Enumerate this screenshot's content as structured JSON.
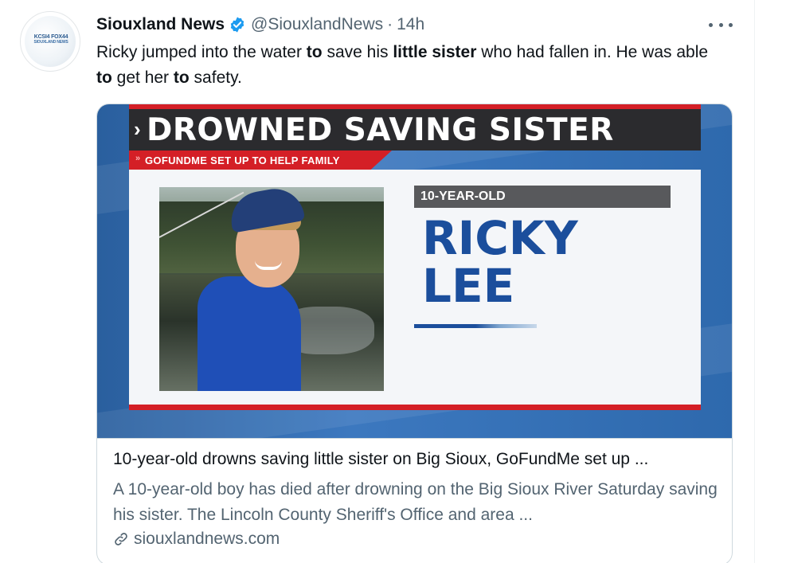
{
  "tweet": {
    "author_name": "Siouxland News",
    "handle": "@SiouxlandNews",
    "separator": "·",
    "time": "14h",
    "text_parts": [
      {
        "t": "Ricky jumped into the water ",
        "b": false
      },
      {
        "t": "to",
        "b": true
      },
      {
        "t": " save his ",
        "b": false
      },
      {
        "t": "little sister",
        "b": true
      },
      {
        "t": " who had fallen in. He was able ",
        "b": false
      },
      {
        "t": "to",
        "b": true
      },
      {
        "t": " get her ",
        "b": false
      },
      {
        "t": "to",
        "b": true
      },
      {
        "t": " safety.",
        "b": false
      }
    ],
    "avatar_logo": {
      "line1": "KCSI4 FOX44",
      "line2": "SIOUXLAND NEWS"
    }
  },
  "card": {
    "graphic": {
      "headline": "DROWNED SAVING SISTER",
      "subheadline": "GOFUNDME SET UP TO HELP FAMILY",
      "age_label": "10-YEAR-OLD",
      "name_line1": "RICKY",
      "name_line2": "LEE"
    },
    "title": "10-year-old drowns saving little sister on Big Sioux, GoFundMe set up ...",
    "description": "A 10-year-old boy has died after drowning on the Big Sioux River Saturday saving his sister. The Lincoln County Sheriff's Office and area ...",
    "domain": "siouxlandnews.com"
  },
  "icons": {
    "verified": "verified-badge-icon",
    "more": "more-options-icon",
    "link": "link-icon"
  },
  "colors": {
    "verified_blue": "#1d9bf0",
    "news_red": "#d41f26",
    "news_blue": "#1b4e9c",
    "muted_text": "#536471"
  }
}
